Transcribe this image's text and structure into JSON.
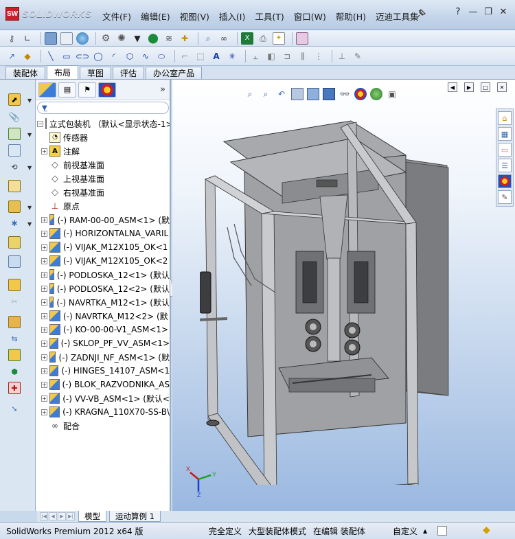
{
  "app": {
    "logo": "SOLIDWORKS",
    "logo_mark": "SW"
  },
  "menu": [
    "文件(F)",
    "编辑(E)",
    "视图(V)",
    "插入(I)",
    "工具(T)",
    "窗口(W)",
    "帮助(H)",
    "迈迪工具集"
  ],
  "window_controls": {
    "help": "?",
    "minimize": "—",
    "restore": "❐",
    "close": "✕"
  },
  "command_tabs": [
    "装配体",
    "布局",
    "草图",
    "评估",
    "办公室产品"
  ],
  "active_command_tab": "布局",
  "feature_tree": {
    "root": "立式包装机 （默认<显示状态-1>",
    "items": [
      {
        "label": "传感器",
        "icon": "sensor-icon",
        "expand": false
      },
      {
        "label": "注解",
        "icon": "annotation-icon",
        "expand": true
      },
      {
        "label": "前视基准面",
        "icon": "plane-icon",
        "expand": false
      },
      {
        "label": "上视基准面",
        "icon": "plane-icon",
        "expand": false
      },
      {
        "label": "右视基准面",
        "icon": "plane-icon",
        "expand": false
      },
      {
        "label": "原点",
        "icon": "origin-icon",
        "expand": false
      },
      {
        "label": "(-) RAM-00-00_ASM<1> (默",
        "icon": "assembly-icon",
        "expand": true
      },
      {
        "label": "(-) HORIZONTALNA_VARIL",
        "icon": "assembly-icon",
        "expand": true
      },
      {
        "label": "(-) VIJAK_M12X105_OK<1",
        "icon": "assembly-icon",
        "expand": true
      },
      {
        "label": "(-) VIJAK_M12X105_OK<2",
        "icon": "assembly-icon",
        "expand": true
      },
      {
        "label": "(-) PODLOSKA_12<1> (默认",
        "icon": "assembly-icon",
        "expand": true
      },
      {
        "label": "(-) PODLOSKA_12<2> (默认",
        "icon": "assembly-icon",
        "expand": true
      },
      {
        "label": "(-) NAVRTKA_M12<1> (默认",
        "icon": "assembly-icon",
        "expand": true
      },
      {
        "label": "(-) NAVRTKA_M12<2> (默",
        "icon": "assembly-icon",
        "expand": true
      },
      {
        "label": "(-) KO-00-00-V1_ASM<1>",
        "icon": "assembly-icon",
        "expand": true
      },
      {
        "label": "(-) SKLOP_PF_VV_ASM<1>",
        "icon": "assembly-icon",
        "expand": true
      },
      {
        "label": "(-) ZADNJI_NF_ASM<1> (默",
        "icon": "assembly-icon",
        "expand": true
      },
      {
        "label": "(-) HINGES_14107_ASM<1",
        "icon": "assembly-icon",
        "expand": true
      },
      {
        "label": "(-) BLOK_RAZVODNIKA_AS",
        "icon": "assembly-icon",
        "expand": true
      },
      {
        "label": "(-) VV-VB_ASM<1> (默认<",
        "icon": "assembly-icon",
        "expand": true
      },
      {
        "label": "(-) KRAGNA_110X70-SS-B\\",
        "icon": "assembly-icon",
        "expand": true
      },
      {
        "label": "配合",
        "icon": "mates-icon",
        "expand": false
      }
    ]
  },
  "bottom_tabs": [
    "模型",
    "运动算例 1"
  ],
  "status": {
    "product": "SolidWorks Premium 2012 x64 版",
    "definition": "完全定义",
    "mode": "大型装配体模式",
    "editing": "在编辑 装配体",
    "units": "自定义",
    "units_arrow": "▲"
  },
  "triad": {
    "x": "X",
    "y": "Y",
    "z": "Z"
  },
  "colors": {
    "title_bg": "#c3d4e9",
    "viewport_top": "#ffffff",
    "viewport_bottom": "#9ab8e0",
    "logo_red": "#c8202b"
  }
}
